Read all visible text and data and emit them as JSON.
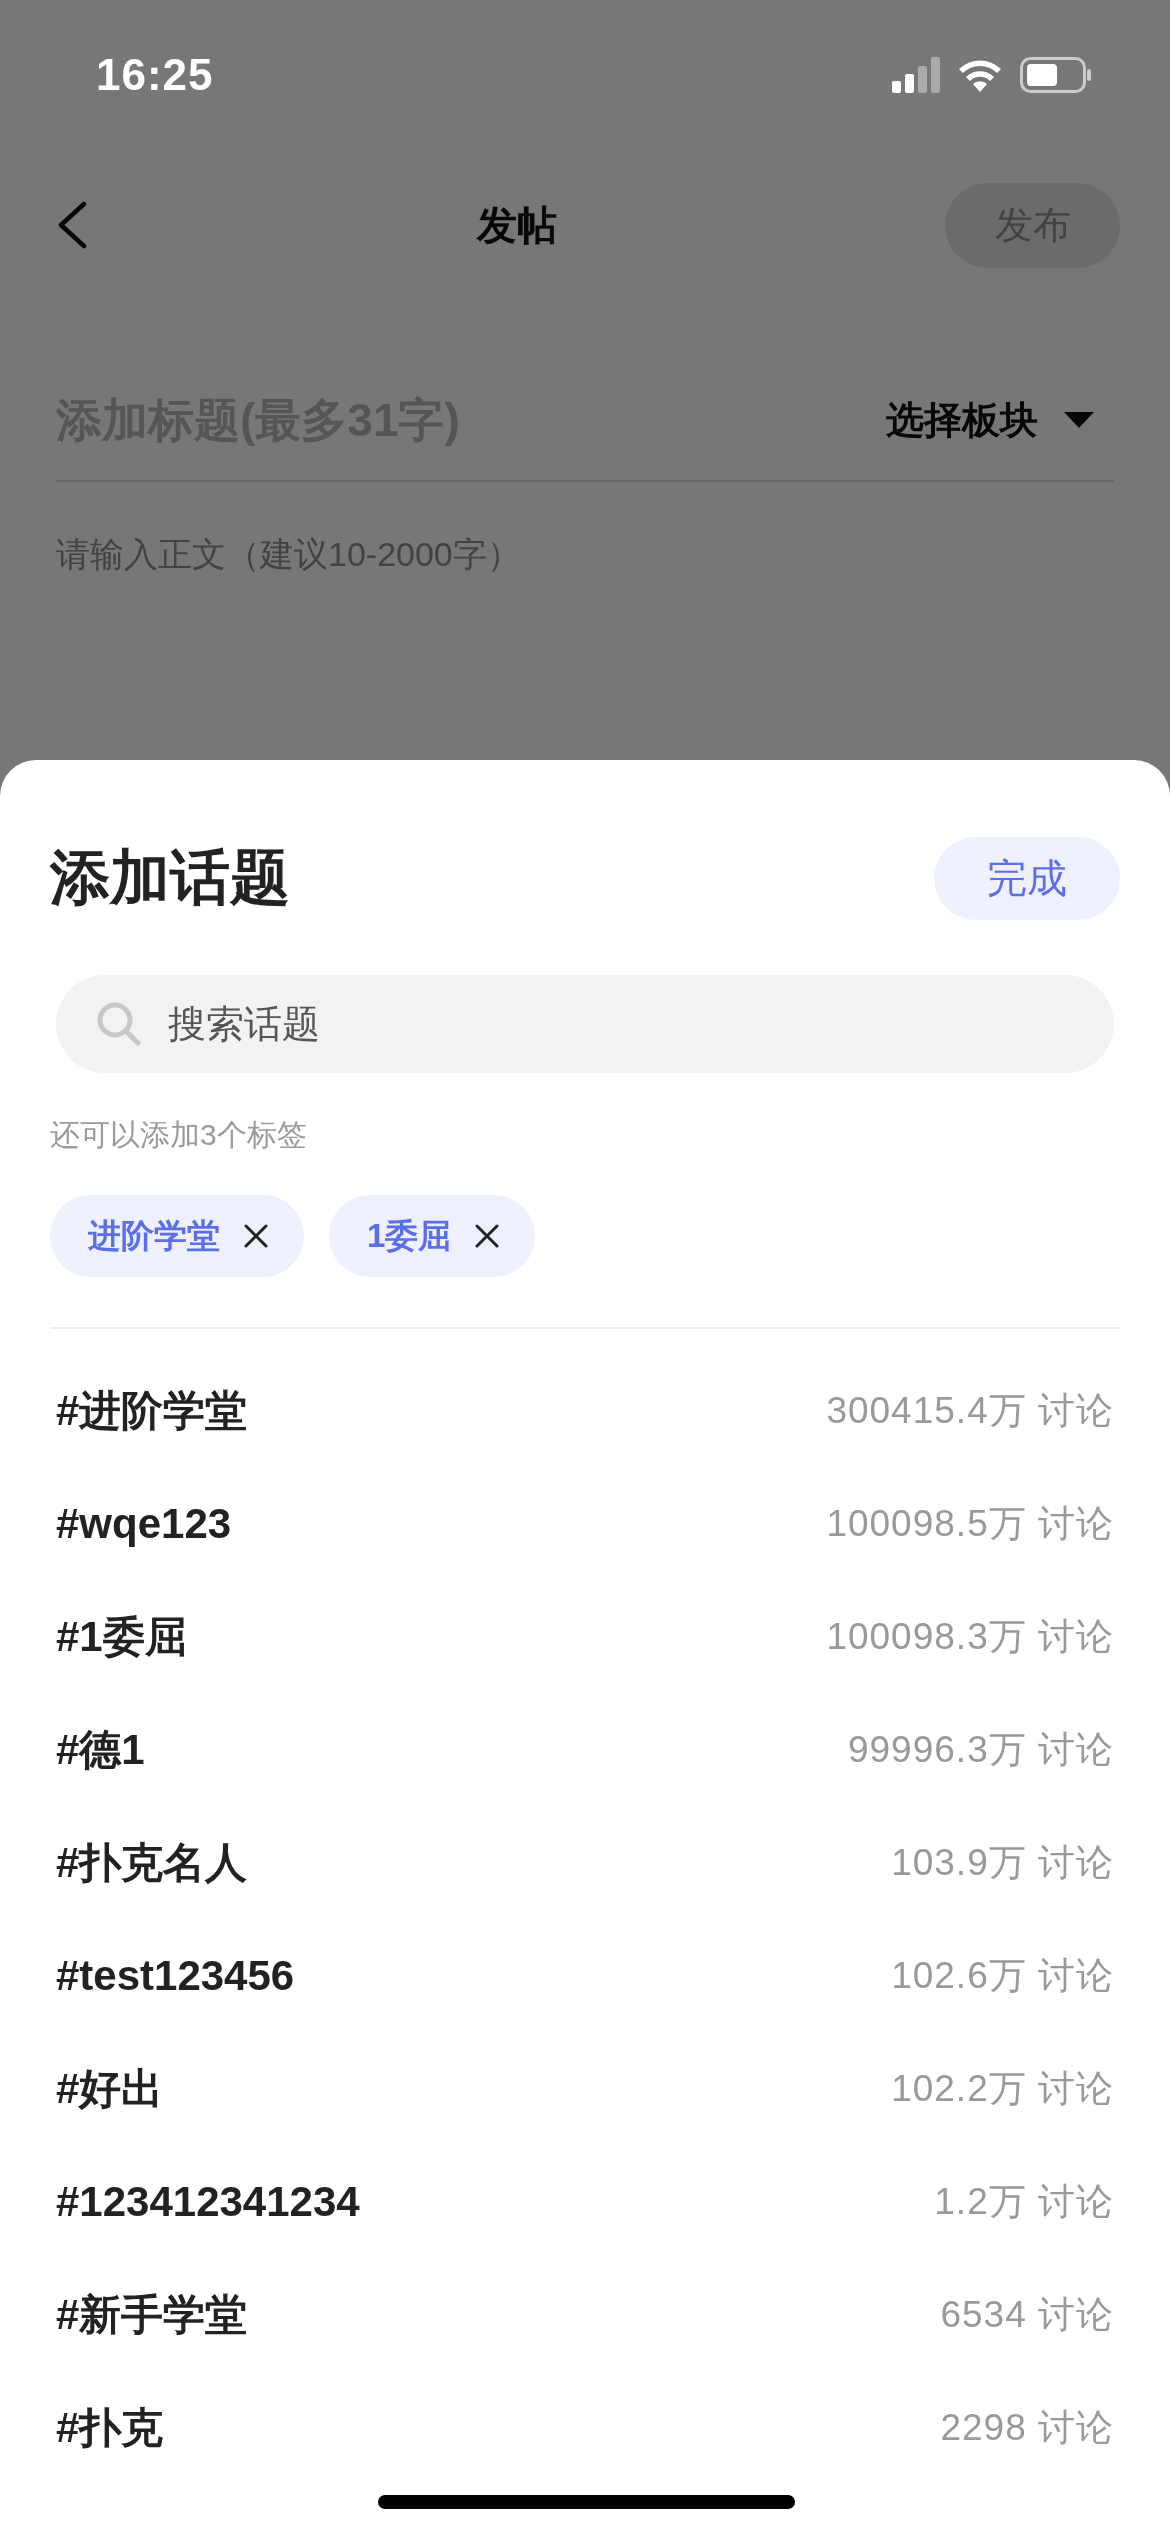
{
  "status_bar": {
    "time": "16:25"
  },
  "nav": {
    "title": "发帖",
    "publish_button": {
      "label": "发布",
      "disabled": true
    }
  },
  "post_form": {
    "title_placeholder": "添加标题(最多31字)",
    "board_selector": "选择板块",
    "body_placeholder": "请输入正文（建议10-2000字）"
  },
  "topic_sheet": {
    "title": "添加话题",
    "done_button": "完成",
    "search": {
      "placeholder": "搜索话题"
    },
    "hint": "还可以添加3个标签",
    "selected_tags": [
      {
        "label": "进阶学堂"
      },
      {
        "label": "1委屈"
      }
    ],
    "topics": [
      {
        "name": "#进阶学堂",
        "count": "300415.4万 讨论"
      },
      {
        "name": "#wqe123",
        "count": "100098.5万 讨论"
      },
      {
        "name": "#1委屈",
        "count": "100098.3万 讨论"
      },
      {
        "name": "#德1",
        "count": "99996.3万 讨论"
      },
      {
        "name": "#扑克名人",
        "count": "103.9万 讨论"
      },
      {
        "name": "#test123456",
        "count": "102.6万 讨论"
      },
      {
        "name": "#好出",
        "count": "102.2万 讨论"
      },
      {
        "name": "#123412341234",
        "count": "1.2万 讨论"
      },
      {
        "name": "#新手学堂",
        "count": "6534 讨论"
      },
      {
        "name": "#扑克",
        "count": "2298 讨论"
      }
    ]
  }
}
